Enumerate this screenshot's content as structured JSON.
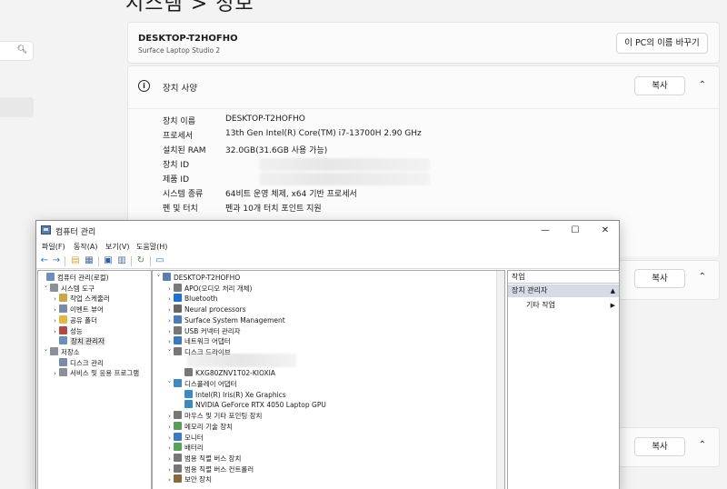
{
  "settings": {
    "title": "시스템 > 정보",
    "device": {
      "name": "DESKTOP-T2HOFHO",
      "model": "Surface Laptop Studio 2",
      "rename_label": "이 PC의 이름 바꾸기"
    },
    "spec": {
      "title": "장치 사양",
      "copy_label": "복사",
      "rows": [
        {
          "k": "장치 이름",
          "v": "DESKTOP-T2HOFHO"
        },
        {
          "k": "프로세서",
          "v": "13th Gen Intel(R) Core(TM) i7-13700H   2.90 GHz"
        },
        {
          "k": "설치된 RAM",
          "v": "32.0GB(31.6GB 사용 가능)"
        },
        {
          "k": "장치 ID",
          "v": ""
        },
        {
          "k": "제품 ID",
          "v": ""
        },
        {
          "k": "시스템 종류",
          "v": "64비트 운영 체제, x64 기반 프로세서"
        },
        {
          "k": "펜 및 터치",
          "v": "펜과 10개 터치 포인트 지원"
        }
      ]
    },
    "lower_copy_1": "복사",
    "lower_copy_2": "복사"
  },
  "cm": {
    "title": "컴퓨터 관리",
    "menus": [
      "파일(F)",
      "동작(A)",
      "보기(V)",
      "도움말(H)"
    ],
    "left_tree": [
      {
        "label": "컴퓨터 관리(로컬)",
        "exp": "",
        "color": "#6b8fb8"
      },
      {
        "label": "시스템 도구",
        "exp": "v",
        "color": "#8a8f98"
      },
      {
        "label": "작업 스케줄러",
        "exp": ">",
        "color": "#caa54a"
      },
      {
        "label": "이벤트 뷰어",
        "exp": ">",
        "color": "#7a8aa0"
      },
      {
        "label": "공유 폴더",
        "exp": ">",
        "color": "#e0b84a"
      },
      {
        "label": "성능",
        "exp": ">",
        "color": "#b04a4a"
      },
      {
        "label": "장치 관리자",
        "exp": "",
        "color": "#6b8fb8"
      },
      {
        "label": "저장소",
        "exp": "v",
        "color": "#8a8f98"
      },
      {
        "label": "디스크 관리",
        "exp": "",
        "color": "#7b8aa8"
      },
      {
        "label": "서비스 및 응용 프로그램",
        "exp": ">",
        "color": "#8a8f98"
      }
    ],
    "mid_tree": [
      {
        "label": "DESKTOP-T2HOFHO",
        "exp": "v",
        "color": "#5a7fa8"
      },
      {
        "label": "APO(오디오 처리 개체)",
        "exp": ">",
        "color": "#7a7a7a"
      },
      {
        "label": "Bluetooth",
        "exp": ">",
        "color": "#1f6fd1"
      },
      {
        "label": "Neural processors",
        "exp": ">",
        "color": "#666"
      },
      {
        "label": "Surface System Management",
        "exp": ">",
        "color": "#4a7db8"
      },
      {
        "label": "USB 커넥터 관리자",
        "exp": ">",
        "color": "#777"
      },
      {
        "label": "네트워크 어댑터",
        "exp": ">",
        "color": "#3c7ac0"
      },
      {
        "label": "디스크 드라이브",
        "exp": "v",
        "color": "#777"
      },
      {
        "label": "",
        "exp": "",
        "color": "transparent"
      },
      {
        "label": "KXG80ZNV1T02-KIOXIA",
        "exp": "",
        "color": "#777"
      },
      {
        "label": "디스플레이 어댑터",
        "exp": "v",
        "color": "#3c8ac0"
      },
      {
        "label": "Intel(R) Iris(R) Xe Graphics",
        "exp": "",
        "color": "#3c8ac0"
      },
      {
        "label": "NVIDIA GeForce RTX 4050 Laptop GPU",
        "exp": "",
        "color": "#3c8ac0"
      },
      {
        "label": "마우스 및 기타 포인팅 장치",
        "exp": ">",
        "color": "#777"
      },
      {
        "label": "메모리 기술 장치",
        "exp": ">",
        "color": "#5a9a5a"
      },
      {
        "label": "모니터",
        "exp": ">",
        "color": "#3c7ac0"
      },
      {
        "label": "배터리",
        "exp": ">",
        "color": "#5aa05a"
      },
      {
        "label": "범용 직렬 버스 장치",
        "exp": ">",
        "color": "#777"
      },
      {
        "label": "범용 직렬 버스 컨트롤러",
        "exp": ">",
        "color": "#777"
      },
      {
        "label": "보안 장치",
        "exp": ">",
        "color": "#8a6a3a"
      }
    ],
    "actions": {
      "header": "작업",
      "selected": "장치 관리자",
      "more": "기타 작업"
    }
  }
}
